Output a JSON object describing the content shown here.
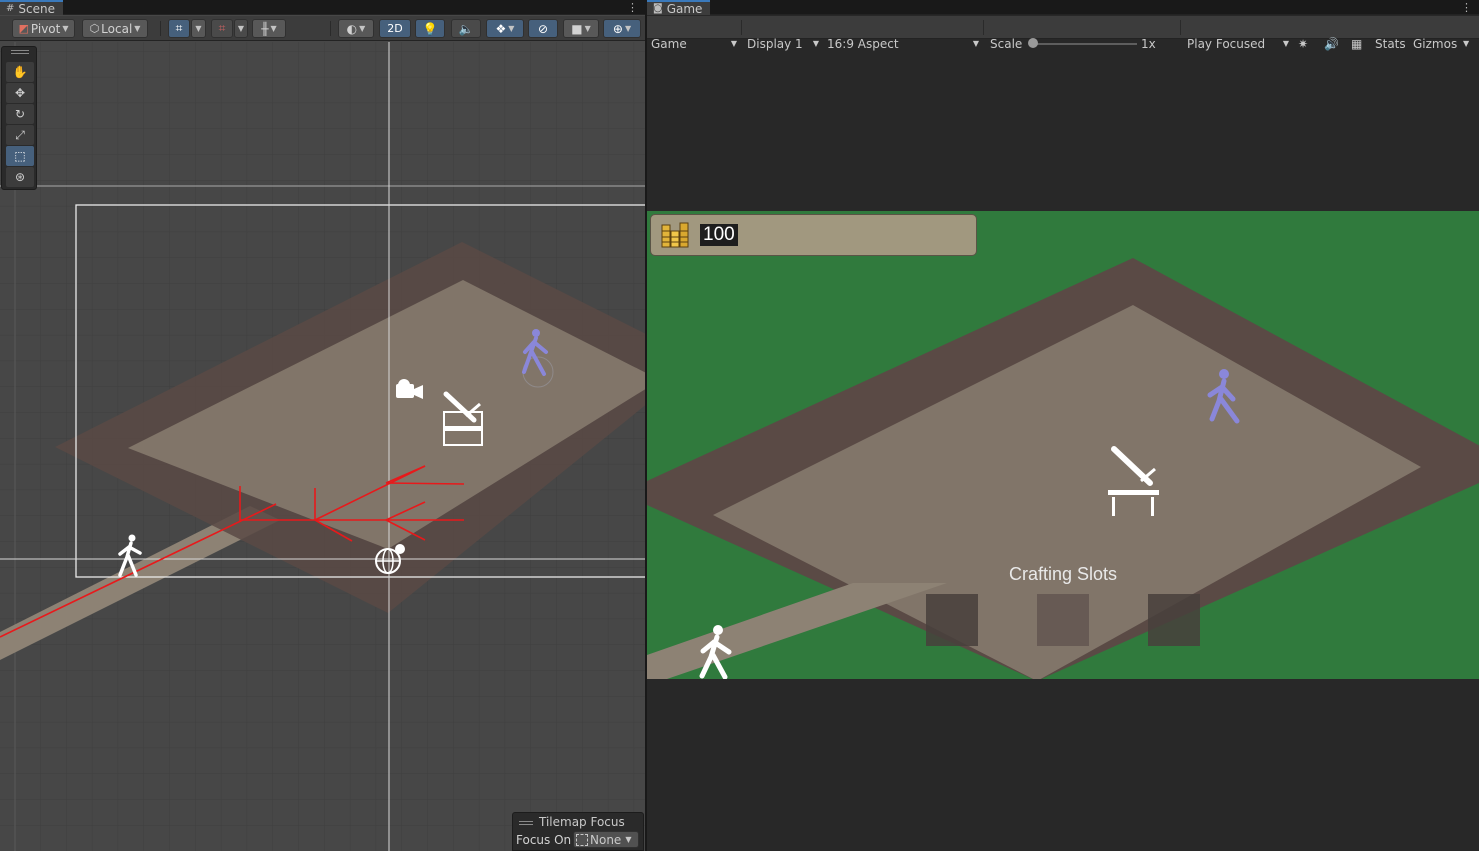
{
  "scene": {
    "tab_label": "Scene",
    "pivot_label": "Pivot",
    "local_label": "Local",
    "mode_2d_label": "2D",
    "tools": [
      "hand-tool",
      "move-tool",
      "rotate-tool",
      "scale-tool",
      "rect-tool",
      "transform-tool"
    ],
    "active_tool": "rect-tool",
    "tilemap_focus": {
      "title": "Tilemap Focus",
      "focus_label": "Focus On",
      "focus_value": "None"
    }
  },
  "game": {
    "tab_label": "Game",
    "toolbar": {
      "view_dropdown": "Game",
      "display_dropdown": "Display 1",
      "aspect_dropdown": "16:9 Aspect",
      "scale_label": "Scale",
      "scale_value": "1x",
      "play_mode_dropdown": "Play Focused",
      "stats_label": "Stats",
      "gizmos_label": "Gizmos"
    },
    "hud": {
      "coin_count": "100",
      "crafting_label": "Crafting Slots",
      "crafting_slot_count": 3
    }
  },
  "colors": {
    "editor_bg": "#474747",
    "toolbar_bg": "#3c3c3c",
    "accent_blue": "#46607c",
    "grass": "#307a3d",
    "wall": "#5a4a45",
    "floor": "#817569",
    "path": "#8d8274",
    "hud_panel": "#a1987f",
    "npc_purple": "#8a87d9",
    "red_gizmo": "#e8191b"
  }
}
